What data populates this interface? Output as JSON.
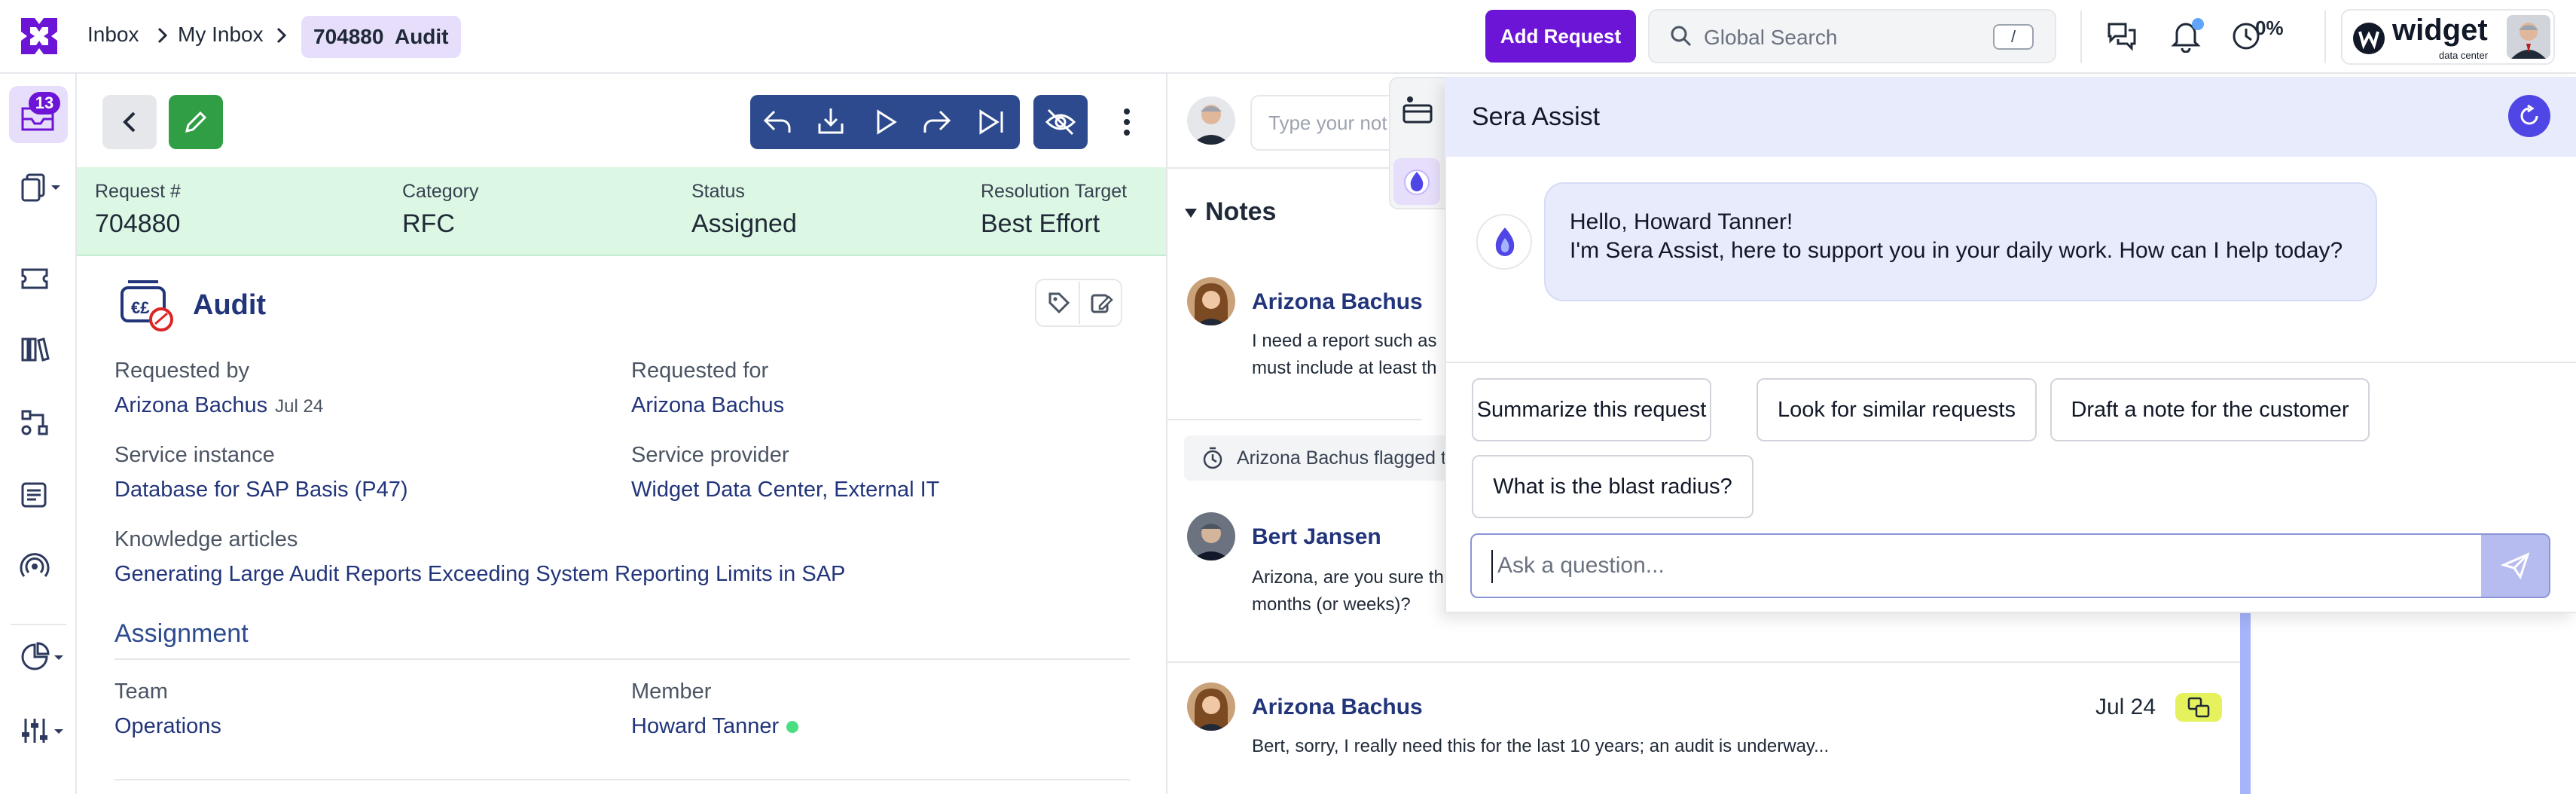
{
  "breadcrumb": {
    "items": [
      "Inbox",
      "My Inbox"
    ],
    "active_number": "704880",
    "active_label": "Audit"
  },
  "topbar": {
    "add_request": "Add Request",
    "search_placeholder": "Global Search",
    "search_shortcut": "/",
    "timer_percent": "0%",
    "brand_name": "widget",
    "brand_sub": "data center"
  },
  "leftrail": {
    "inbox_badge": "13",
    "items": [
      "inbox-icon",
      "documents-icon",
      "tickets-icon",
      "library-icon",
      "workflow-icon",
      "list-icon",
      "broadcast-icon",
      "reports-icon",
      "settings-icon"
    ]
  },
  "summary": {
    "request_label": "Request #",
    "request_value": "704880",
    "category_label": "Category",
    "category_value": "RFC",
    "status_label": "Status",
    "status_value": "Assigned",
    "resolution_label": "Resolution Target",
    "resolution_value": "Best Effort"
  },
  "request": {
    "title": "Audit",
    "requested_by_label": "Requested by",
    "requested_by": "Arizona Bachus",
    "requested_by_date": "Jul 24",
    "requested_for_label": "Requested for",
    "requested_for": "Arizona Bachus",
    "service_instance_label": "Service instance",
    "service_instance": "Database for SAP Basis (P47)",
    "service_provider_label": "Service provider",
    "service_provider": "Widget Data Center, External IT",
    "knowledge_label": "Knowledge articles",
    "knowledge_article": "Generating Large Audit Reports Exceeding System Reporting Limits in SAP"
  },
  "assignment": {
    "title": "Assignment",
    "team_label": "Team",
    "team_value": "Operations",
    "member_label": "Member",
    "member_value": "Howard Tanner"
  },
  "notes": {
    "input_placeholder": "Type your not",
    "header": "Notes",
    "items": [
      {
        "author": "Arizona Bachus",
        "text_line1": "I need a report such as",
        "text_line2": "must include at least th"
      },
      {
        "author": "Bert Jansen",
        "text_line1": "Arizona, are you sure th",
        "text_line2": "months (or weeks)?"
      },
      {
        "author": "Arizona Bachus",
        "date": "Jul 24",
        "text_line1": "Bert, sorry, I really need this for the last 10 years; an audit is underway..."
      }
    ],
    "flag_text": "Arizona Bachus flagged t"
  },
  "assist": {
    "title": "Sera Assist",
    "greeting_line1": "Hello, Howard Tanner!",
    "greeting_line2": "I'm Sera Assist, here to support you in your daily work. How can I help today?",
    "suggestions": [
      "Summarize this request",
      "Look for similar requests",
      "Draft a note for the customer",
      "What is the blast radius?"
    ],
    "input_placeholder": "Ask a question..."
  },
  "colors": {
    "accent_purple": "#6d15d6",
    "toolbar_blue": "#2d4a8e",
    "link_blue": "#22357a",
    "summary_green": "#dcf7e3",
    "assist_header": "#e7ebfb",
    "online_green": "#4ade80"
  }
}
